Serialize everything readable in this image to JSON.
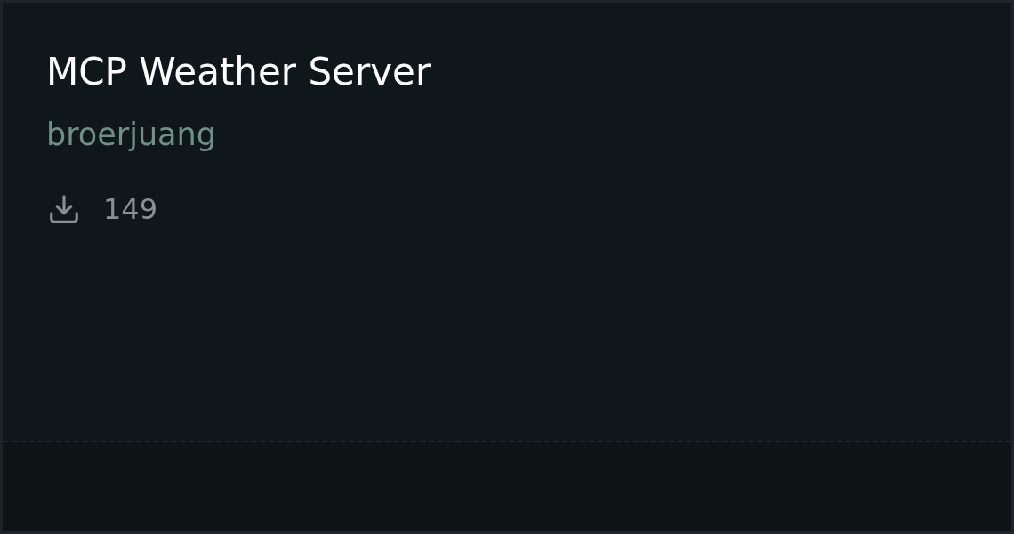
{
  "card": {
    "title": "MCP Weather Server",
    "author": "broerjuang",
    "downloads": "149"
  }
}
